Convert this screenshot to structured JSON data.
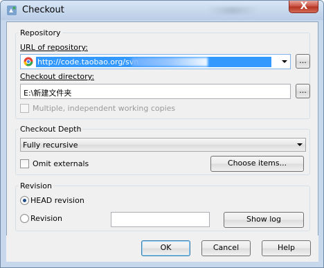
{
  "window": {
    "title": "Checkout",
    "close_label": "X"
  },
  "repository": {
    "group_label": "Repository",
    "url_label": "URL of repository:",
    "url_value": "http://code.taobao.org/svn",
    "ellipsis_label": "...",
    "checkout_dir_label": "Checkout directory:",
    "checkout_dir_value": "E:\\新建文件夹",
    "working_copies_label": "Multiple, independent working copies"
  },
  "checkout_depth": {
    "group_label": "Checkout Depth",
    "selected_value": "Fully recursive",
    "omit_externals_label": "Omit externals",
    "choose_items_label": "Choose items..."
  },
  "revision": {
    "group_label": "Revision",
    "head_label": "HEAD revision",
    "revision_label": "Revision",
    "revision_value": "",
    "show_log_label": "Show log"
  },
  "footer": {
    "ok_label": "OK",
    "cancel_label": "Cancel",
    "help_label": "Help"
  },
  "icons": {
    "app": "tortoise-svn-icon",
    "url": "chrome-icon",
    "close": "close-icon"
  },
  "colors": {
    "selection": "#3399ff",
    "dialog_background": "#f0f0f0",
    "frame": "#c8d8ec",
    "close_button": "#c7503f"
  }
}
